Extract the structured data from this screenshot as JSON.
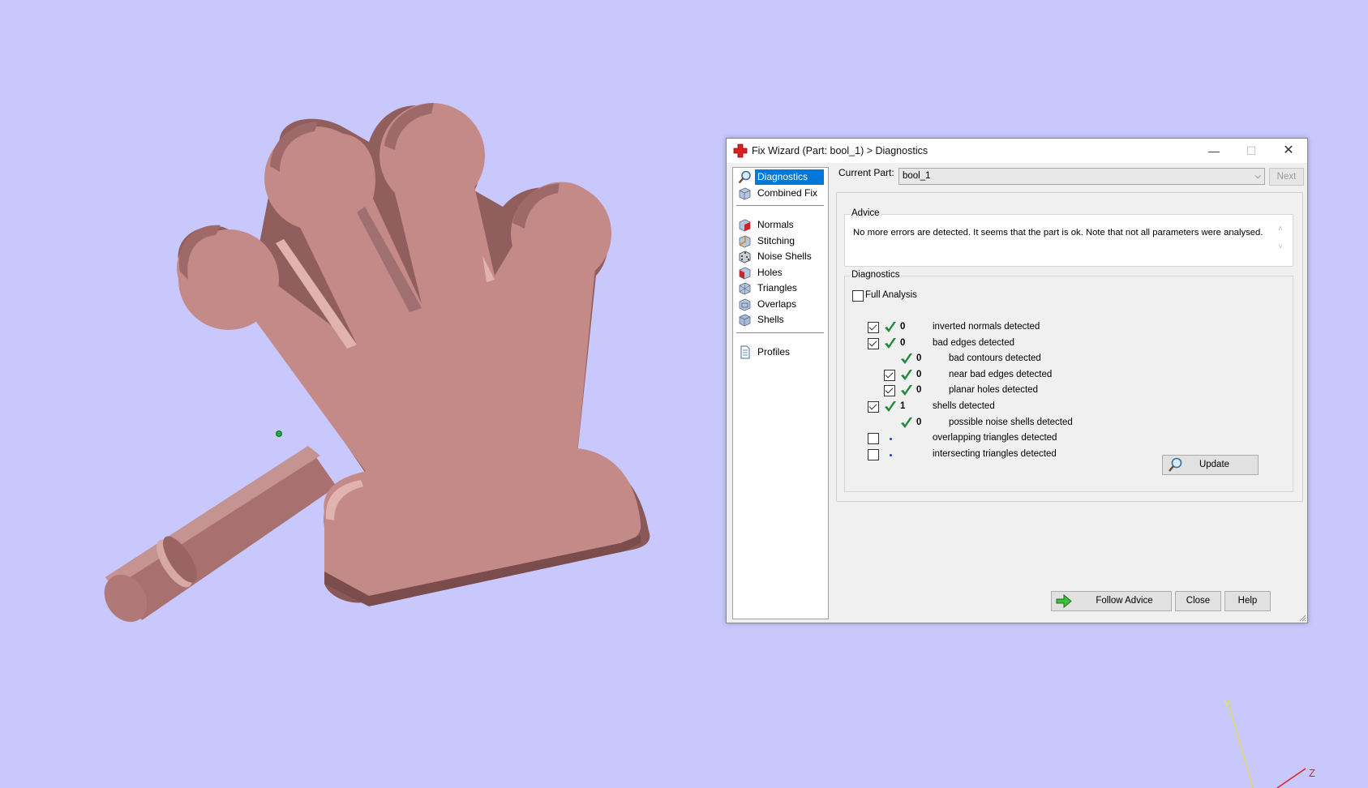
{
  "dialog": {
    "title": "Fix Wizard (Part: bool_1) > Diagnostics",
    "icon": "red-cross-icon"
  },
  "nav": {
    "top_items": [
      {
        "label": "Diagnostics",
        "icon": "magnifier-icon",
        "selected": true
      },
      {
        "label": "Combined Fix",
        "icon": "cube-icon"
      }
    ],
    "tool_items": [
      {
        "label": "Normals",
        "icon": "normals-cube-icon"
      },
      {
        "label": "Stitching",
        "icon": "stitching-cube-icon"
      },
      {
        "label": "Noise Shells",
        "icon": "noise-dice-icon"
      },
      {
        "label": "Holes",
        "icon": "holes-cube-icon"
      },
      {
        "label": "Triangles",
        "icon": "triangles-cube-icon"
      },
      {
        "label": "Overlaps",
        "icon": "overlaps-cube-icon"
      },
      {
        "label": "Shells",
        "icon": "shells-cube-icon"
      }
    ],
    "bottom_items": [
      {
        "label": "Profiles",
        "icon": "document-icon"
      }
    ]
  },
  "current_part": {
    "label": "Current Part:",
    "value": "bool_1",
    "next_label": "Next"
  },
  "advice": {
    "title": "Advice",
    "text": "No more errors are detected. It seems that the part is ok. Note that not all parameters were analysed."
  },
  "diagnostics": {
    "title": "Diagnostics",
    "full_analysis_label": "Full Analysis",
    "full_analysis_checked": false,
    "rows": [
      {
        "checkbox": true,
        "checked": true,
        "status": "ok",
        "count": "0",
        "label": "inverted normals detected",
        "indent": 0
      },
      {
        "checkbox": true,
        "checked": true,
        "status": "ok",
        "count": "0",
        "label": "bad edges detected",
        "indent": 0
      },
      {
        "checkbox": false,
        "checked": false,
        "status": "ok",
        "count": "0",
        "label": "bad contours detected",
        "indent": 1
      },
      {
        "checkbox": true,
        "checked": true,
        "status": "ok",
        "count": "0",
        "label": "near bad edges detected",
        "indent": 1
      },
      {
        "checkbox": true,
        "checked": true,
        "status": "ok",
        "count": "0",
        "label": "planar holes detected",
        "indent": 1
      },
      {
        "checkbox": true,
        "checked": true,
        "status": "ok",
        "count": "1",
        "label": "shells detected",
        "indent": 0
      },
      {
        "checkbox": false,
        "checked": false,
        "status": "ok",
        "count": "0",
        "label": "possible noise shells detected",
        "indent": 1
      },
      {
        "checkbox": true,
        "checked": false,
        "status": "pending",
        "count": "",
        "label": "overlapping triangles detected",
        "indent": 0
      },
      {
        "checkbox": true,
        "checked": false,
        "status": "pending",
        "count": "",
        "label": "intersecting triangles detected",
        "indent": 0
      }
    ],
    "update_label": "Update"
  },
  "buttons": {
    "follow_advice": "Follow Advice",
    "close": "Close",
    "help": "Help"
  },
  "axes": {
    "y_label": "Y",
    "z_label": "Z"
  },
  "colors": {
    "background": "#c8c8fd",
    "model": "#c48a88",
    "selection": "#0078d7",
    "ok_tick": "#1e8a3a"
  }
}
